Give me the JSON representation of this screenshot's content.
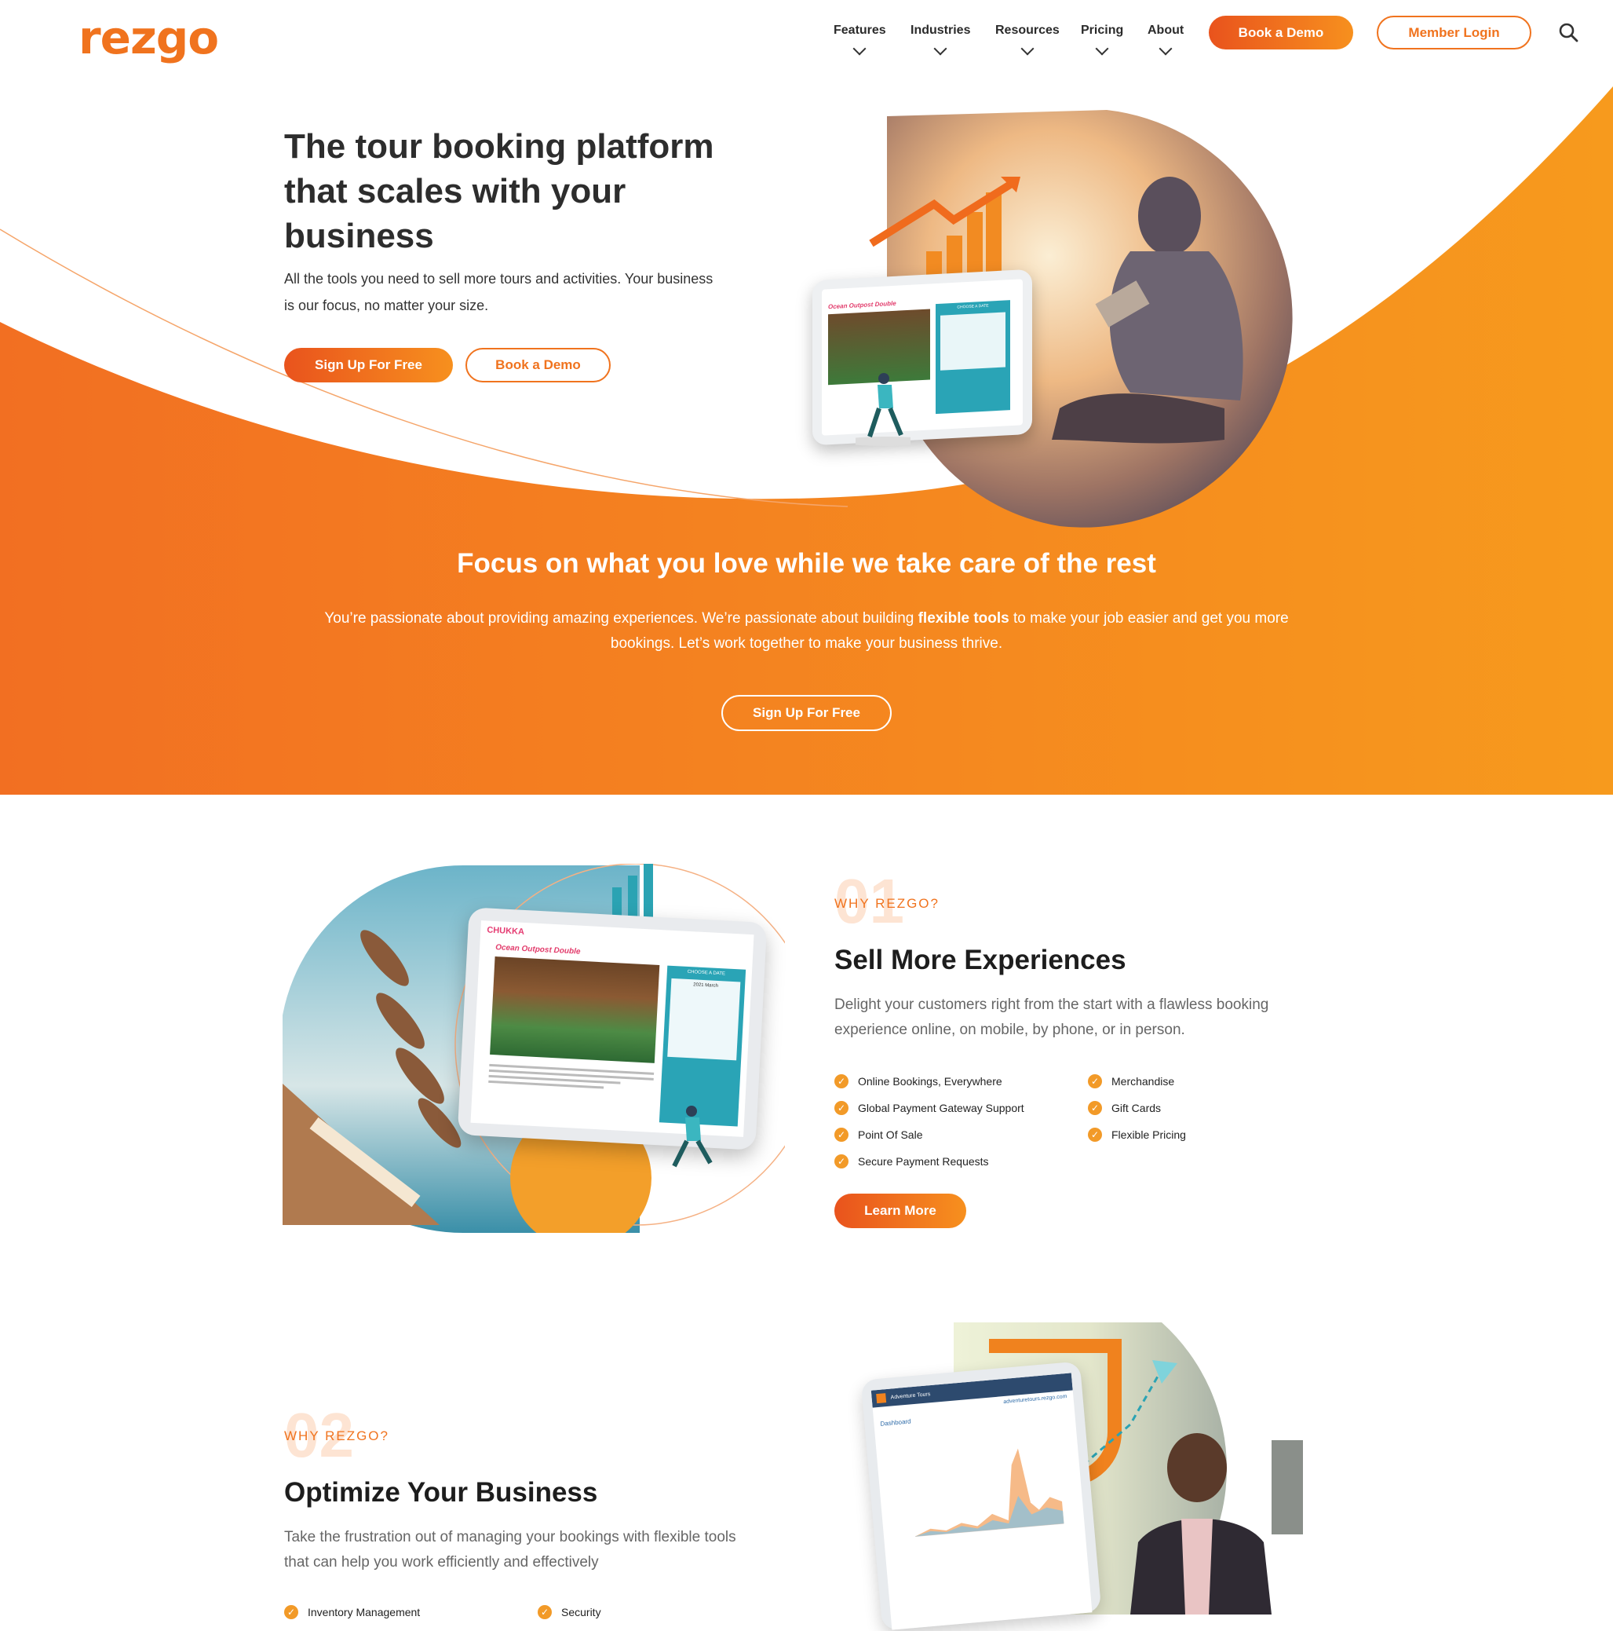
{
  "header": {
    "logo": "rezgo",
    "nav": [
      {
        "label": "Features"
      },
      {
        "label": "Industries"
      },
      {
        "label": "Resources"
      },
      {
        "label": "Pricing"
      },
      {
        "label": "About"
      }
    ],
    "book_demo": "Book a Demo",
    "member_login": "Member Login"
  },
  "hero": {
    "title": "The tour booking platform that scales with your business",
    "subtitle": "All the tools you need to sell more tours and activities. Your business is our focus, no matter your size.",
    "signup": "Sign Up For Free",
    "demo": "Book a Demo",
    "tablet_title": "Ocean Outpost Double",
    "tablet_calendar": "CHOOSE A DATE"
  },
  "focus": {
    "title": "Focus on what you love while we take care of the rest",
    "text_before": "You’re passionate about providing amazing experiences. We’re passionate about building ",
    "text_bold": "flexible tools",
    "text_after": " to make your job easier and get you more bookings. Let’s work together to make your business thrive.",
    "signup": "Sign Up For Free"
  },
  "section1": {
    "num": "01",
    "label": "WHY REZGO?",
    "title": "Sell More Experiences",
    "text": "Delight your customers right from the start with a flawless booking experience online, on mobile, by phone, or in person.",
    "features_left": [
      "Online Bookings, Everywhere",
      "Global Payment Gateway Support",
      "Point Of Sale",
      "Secure Payment Requests"
    ],
    "features_right": [
      "Merchandise",
      "Gift Cards",
      "Flexible Pricing"
    ],
    "learn_more": "Learn More",
    "tablet_brand": "CHUKKA",
    "tablet_title": "Ocean Outpost Double",
    "tablet_calendar": "CHOOSE A DATE",
    "tablet_month": "2021 March"
  },
  "section2": {
    "num": "02",
    "label": "WHY REZGO?",
    "title": "Optimize Your Business",
    "text": "Take the frustration out of managing your bookings with flexible tools that can help you work efficiently and effectively",
    "features_left": [
      "Inventory Management"
    ],
    "features_right": [
      "Security"
    ],
    "tablet_app": "Adventure Tours",
    "tablet_dashboard": "Dashboard",
    "tablet_url": "adventuretours.rezgo.com"
  },
  "colors": {
    "accent": "#f0731e",
    "accent_dark": "#e9531d",
    "accent_light": "#f7901e"
  }
}
